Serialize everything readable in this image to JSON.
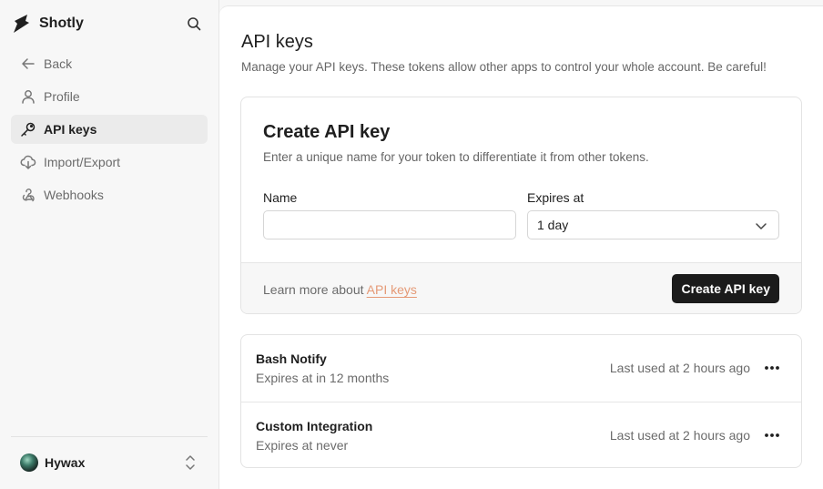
{
  "app": {
    "name": "Shotly"
  },
  "sidebar": {
    "items": [
      {
        "label": "Back",
        "icon": "arrow-left-icon",
        "active": false
      },
      {
        "label": "Profile",
        "icon": "user-icon",
        "active": false
      },
      {
        "label": "API keys",
        "icon": "key-icon",
        "active": true
      },
      {
        "label": "Import/Export",
        "icon": "cloud-download-icon",
        "active": false
      },
      {
        "label": "Webhooks",
        "icon": "webhook-icon",
        "active": false
      }
    ],
    "user": {
      "name": "Hywax"
    }
  },
  "page": {
    "title": "API keys",
    "subtitle": "Manage your API keys. These tokens allow other apps to control your whole account. Be careful!"
  },
  "create_form": {
    "title": "Create API key",
    "description": "Enter a unique name for your token to differentiate it from other tokens.",
    "name_label": "Name",
    "name_value": "",
    "name_placeholder": "",
    "expires_label": "Expires at",
    "expires_value": "1 day",
    "footer_text": "Learn more about ",
    "footer_link": "API keys",
    "submit_label": "Create API key"
  },
  "api_keys": [
    {
      "name": "Bash Notify",
      "expires": "Expires at in 12 months",
      "last_used": "Last used at 2 hours ago"
    },
    {
      "name": "Custom Integration",
      "expires": "Expires at never",
      "last_used": "Last used at 2 hours ago"
    }
  ],
  "colors": {
    "accent_link": "#e59a77",
    "primary_button": "#1b1b1b",
    "sidebar_bg": "#f7f7f7",
    "active_item_bg": "#ebebeb"
  }
}
